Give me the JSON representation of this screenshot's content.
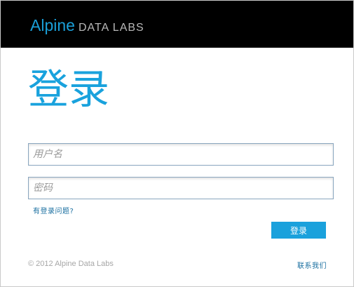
{
  "header": {
    "brand_main": "Alpine",
    "brand_sub": "DATA LABS"
  },
  "login": {
    "title": "登录",
    "username_placeholder": "用户名",
    "username_value": "",
    "password_placeholder": "密码",
    "password_value": "",
    "forgot_link": "有登录问题?",
    "submit_label": "登录"
  },
  "footer": {
    "copyright": "© 2012 Alpine Data Labs",
    "contact_link": "联系我们"
  },
  "colors": {
    "accent": "#1aa1dc",
    "header_bg": "#000000",
    "link": "#1a6fa0"
  }
}
